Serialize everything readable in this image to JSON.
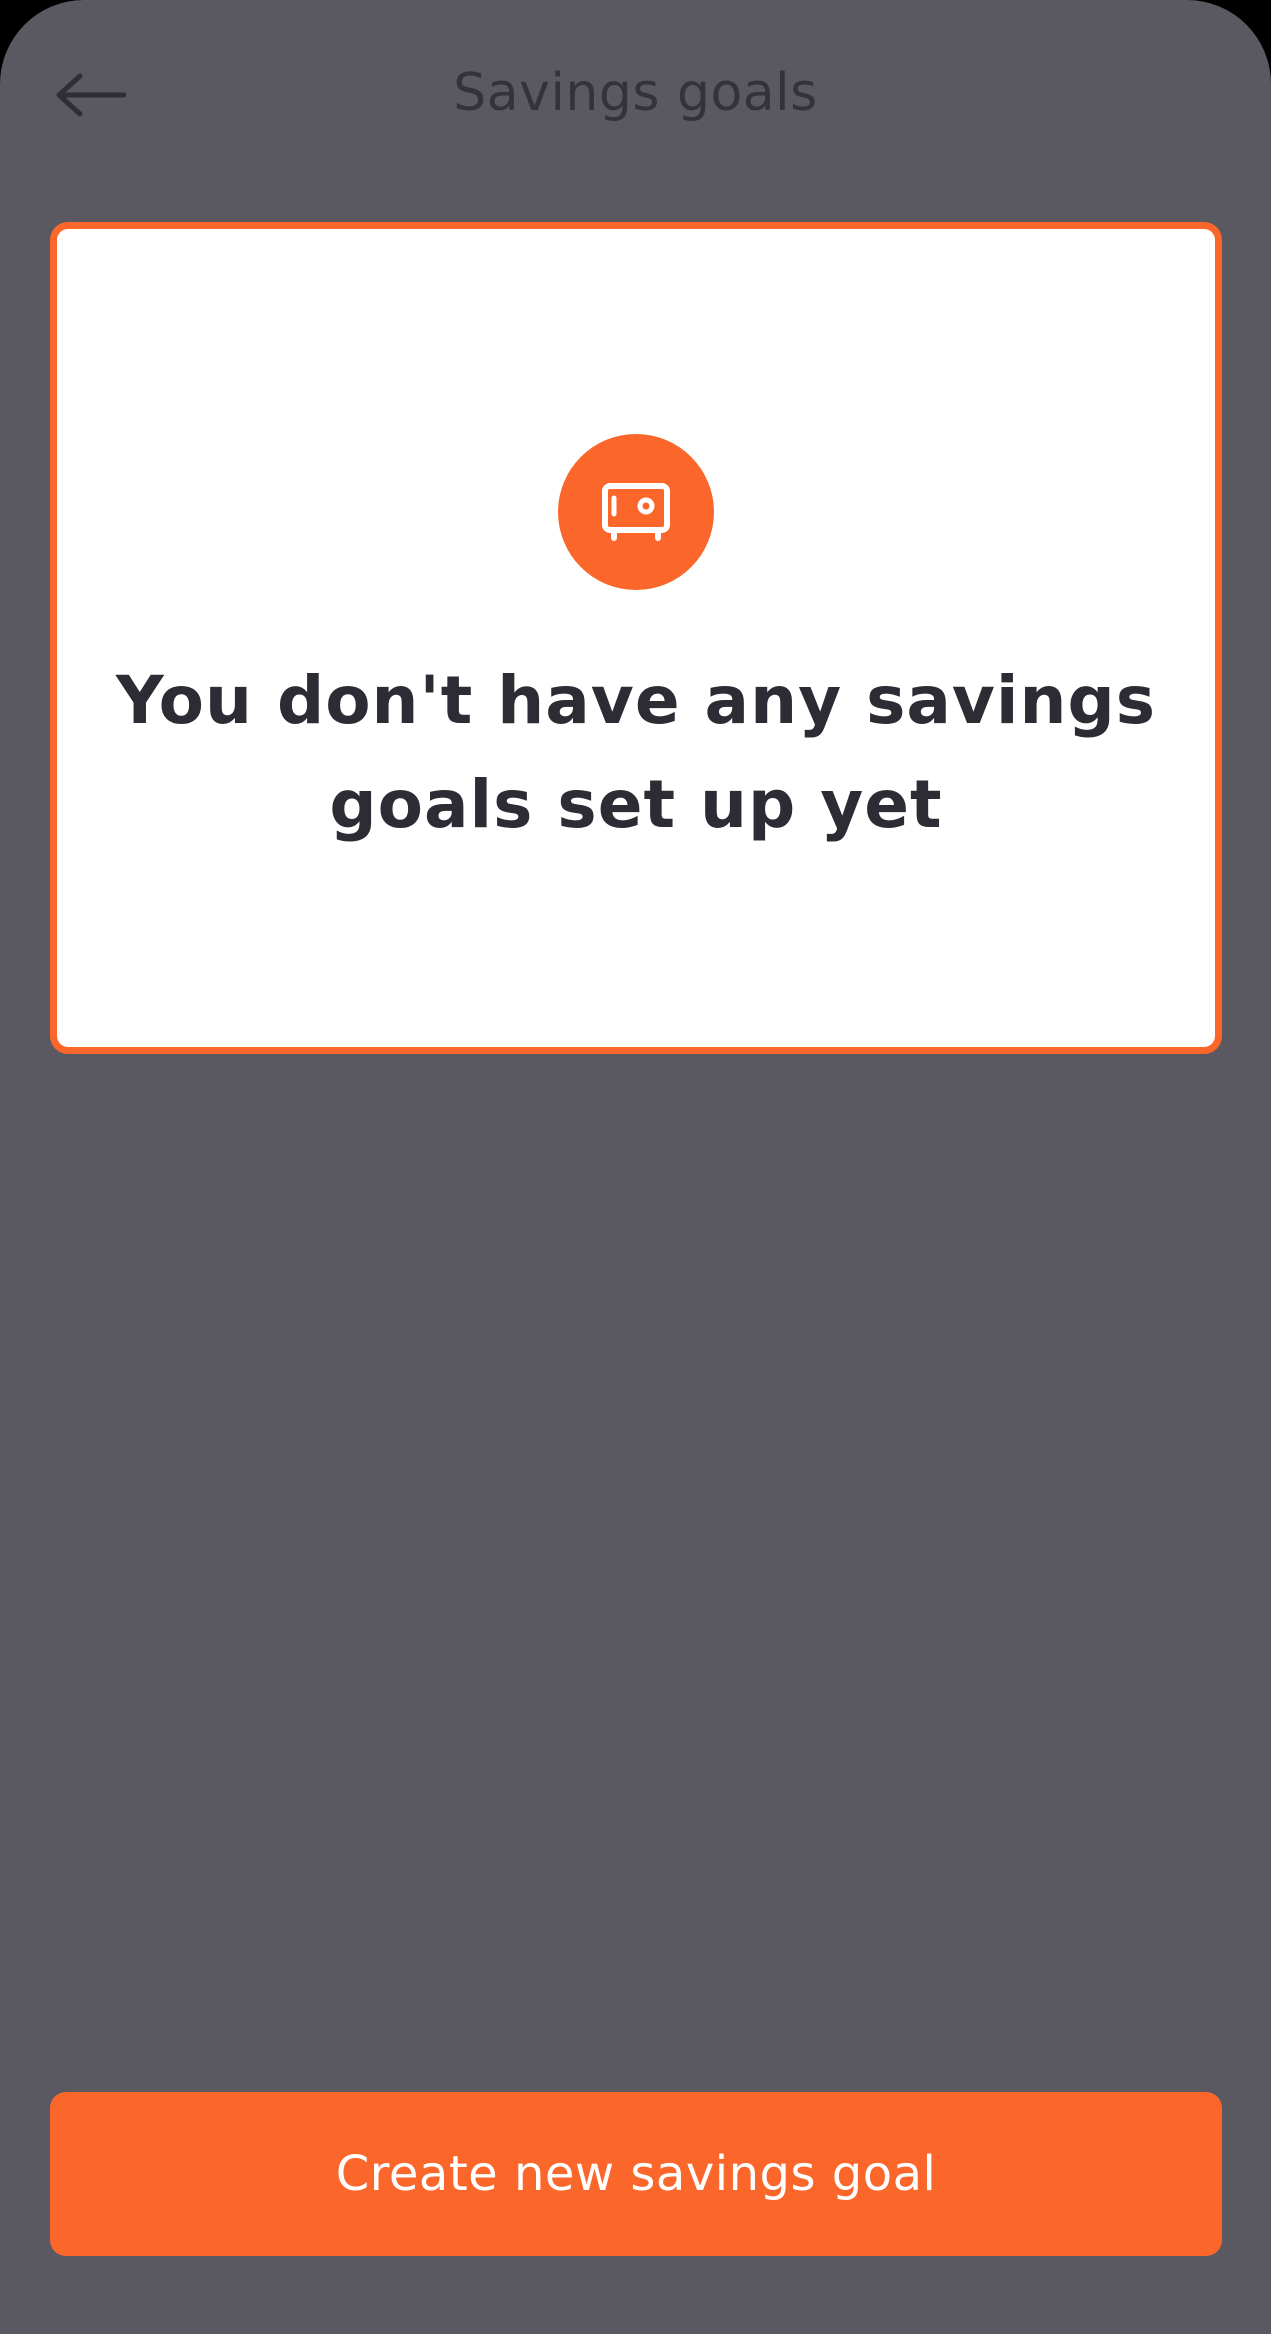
{
  "header": {
    "title": "Savings goals",
    "back_icon": "arrow-left-icon"
  },
  "empty_state": {
    "icon": "safe-icon",
    "message": "You don't have any savings goals set up yet"
  },
  "footer": {
    "create_button_label": "Create new savings goal"
  },
  "colors": {
    "accent": "#fb662b",
    "background": "#5a5962",
    "card": "#ffffff",
    "text_dark": "#2d2b33"
  }
}
